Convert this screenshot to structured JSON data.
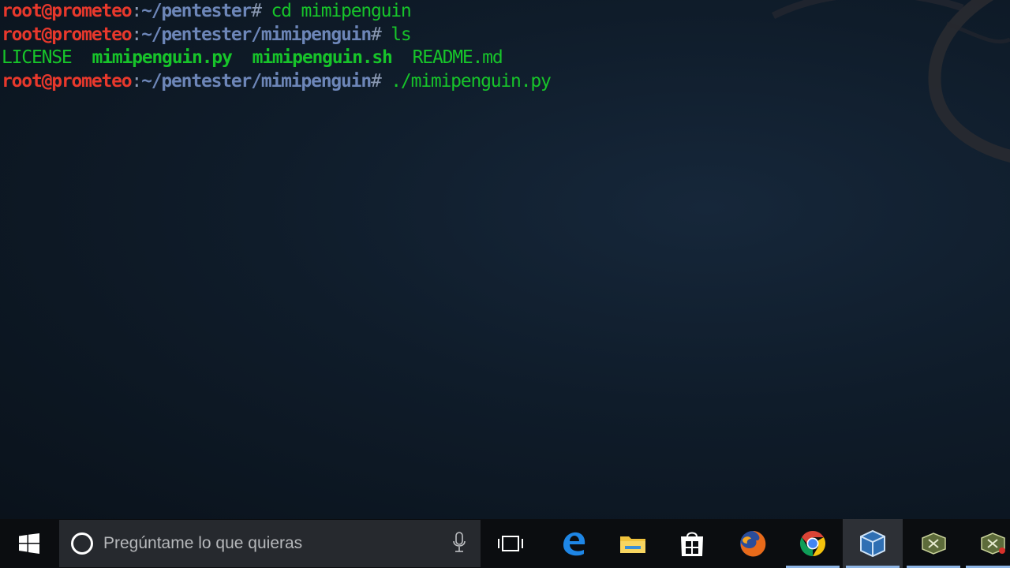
{
  "terminal": {
    "lines": [
      {
        "user": "root@prometeo",
        "colon": ":",
        "path": "~/pentester",
        "hash": "#",
        "command": "cd mimipenguin"
      },
      {
        "user": "root@prometeo",
        "colon": ":",
        "path": "~/pentester/mimipenguin",
        "hash": "#",
        "command": "ls"
      },
      {
        "files": [
          "LICENSE",
          "mimipenguin.py",
          "mimipenguin.sh",
          "README.md"
        ]
      },
      {
        "user": "root@prometeo",
        "colon": ":",
        "path": "~/pentester/mimipenguin",
        "hash": "#",
        "command": "./mimipenguin.py"
      }
    ]
  },
  "taskbar": {
    "search_placeholder": "Pregúntame lo que quieras",
    "icons": {
      "start": "windows-start-icon",
      "cortana": "cortana-icon",
      "mic": "microphone-icon",
      "task_view": "task-view-icon",
      "apps": [
        "edge-icon",
        "file-explorer-icon",
        "store-icon",
        "firefox-icon",
        "chrome-icon",
        "virtualbox-icon",
        "app-icon",
        "app-icon"
      ]
    }
  },
  "colors": {
    "prompt_user": "#e8382c",
    "prompt_path": "#6d86b8",
    "command": "#17c42a",
    "taskbar_bg": "#0b0d10",
    "search_bg": "#26292e"
  }
}
